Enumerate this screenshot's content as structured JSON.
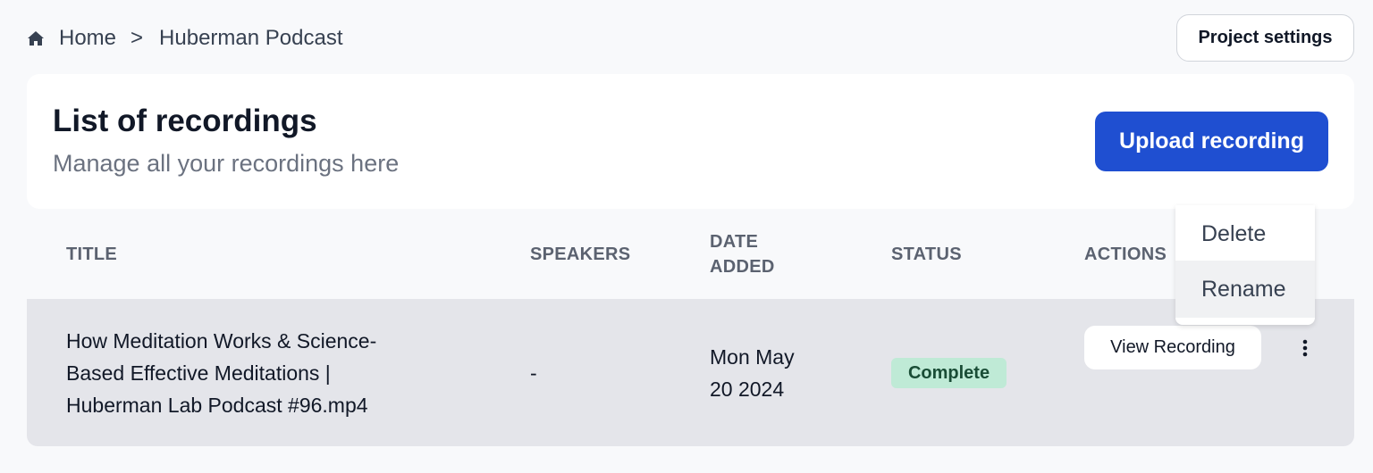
{
  "breadcrumb": {
    "icon": "home-icon",
    "items": [
      "Home",
      "Huberman Podcast"
    ],
    "separator": ">"
  },
  "header": {
    "project_settings_label": "Project settings"
  },
  "card": {
    "title": "List of recordings",
    "subtitle": "Manage all your recordings here",
    "upload_label": "Upload recording",
    "accent_color": "#1f4fd1"
  },
  "table": {
    "columns": [
      "TITLE",
      "SPEAKERS",
      "DATE ADDED",
      "STATUS",
      "ACTIONS"
    ],
    "date_header_lines": [
      "DATE",
      "ADDED"
    ],
    "rows": [
      {
        "title_lines": [
          "How Meditation Works & Science-",
          "Based Effective Meditations |",
          "Huberman Lab Podcast #96.mp4"
        ],
        "speakers": "-",
        "date_lines": [
          "Mon May",
          "20 2024"
        ],
        "status": "Complete",
        "status_color": "#bfead6",
        "view_label": "View Recording",
        "more_icon": "kebab-vertical-icon"
      }
    ]
  },
  "dropdown_menu": {
    "items": [
      "Delete",
      "Rename"
    ],
    "highlighted": "Rename"
  }
}
